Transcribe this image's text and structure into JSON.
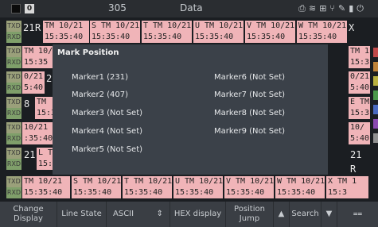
{
  "header": {
    "counter": "305",
    "title": "Data",
    "left_badge": "0"
  },
  "rows": [
    {
      "ch1": "21",
      "ch2": "R",
      "cells": [
        "TM 10/21\n15:35:40",
        "S TM 10/21\n15:35:40",
        "T TM 10/21\n15:35:40",
        "U TM 10/21\n15:35:40",
        "V TM 10/21\n15:35:40",
        "W TM 10/21\n15:35:40"
      ],
      "end": "X"
    },
    {
      "ch1": "TM 10/\n15:35",
      "ch2": "",
      "cells": [],
      "end": "TM 1\n15:3"
    },
    {
      "ch1": "0/21\n5:40",
      "ch2": "2",
      "cells": [],
      "end": "0/21\n5:40"
    },
    {
      "ch1": "8",
      "ch2": "TM\n15:3",
      "cells": [],
      "end": "E TM 1\n15:3"
    },
    {
      "ch1": "10/21\n:35:40",
      "ch2": "",
      "cells": [],
      "end": "10/\n5:40"
    },
    {
      "ch1": "21",
      "ch2": "L TM\n15:3",
      "cells": [],
      "end": "21 R\n40"
    },
    {
      "ch1": "TM 10/21\n15:35:40",
      "ch2": "",
      "cells": [
        "S TM 10/21\n15:35:40",
        "T TM 10/21\n15:35:40",
        "U TM 10/21\n15:35:40",
        "V TM 10/21\n15:35:40",
        "W TM 10/21\n15:35:40"
      ],
      "end": "X TM 1\n15:3"
    }
  ],
  "tags": {
    "txd": "TXD",
    "rxd": "RXD"
  },
  "modal": {
    "title": "Mark Position",
    "markers": [
      "Marker1 (231)",
      "Marker2 (407)",
      "Marker3 (Not Set)",
      "Marker4 (Not Set)",
      "Marker5 (Not Set)",
      "Marker6 (Not Set)",
      "Marker7 (Not Set)",
      "Marker8 (Not Set)",
      "Marker9 (Not Set)"
    ]
  },
  "toolbar": {
    "change_display": "Change\nDisplay",
    "line_state": "Line State",
    "encoding": "ASCII",
    "hex_display": "HEX display",
    "position_jump": "Position\nJump",
    "search": "Search"
  },
  "colors": {
    "cell_bg": "#f0b4b8",
    "modal_bg": "#3b4149",
    "toolbar_bg": "#3a3e44"
  }
}
